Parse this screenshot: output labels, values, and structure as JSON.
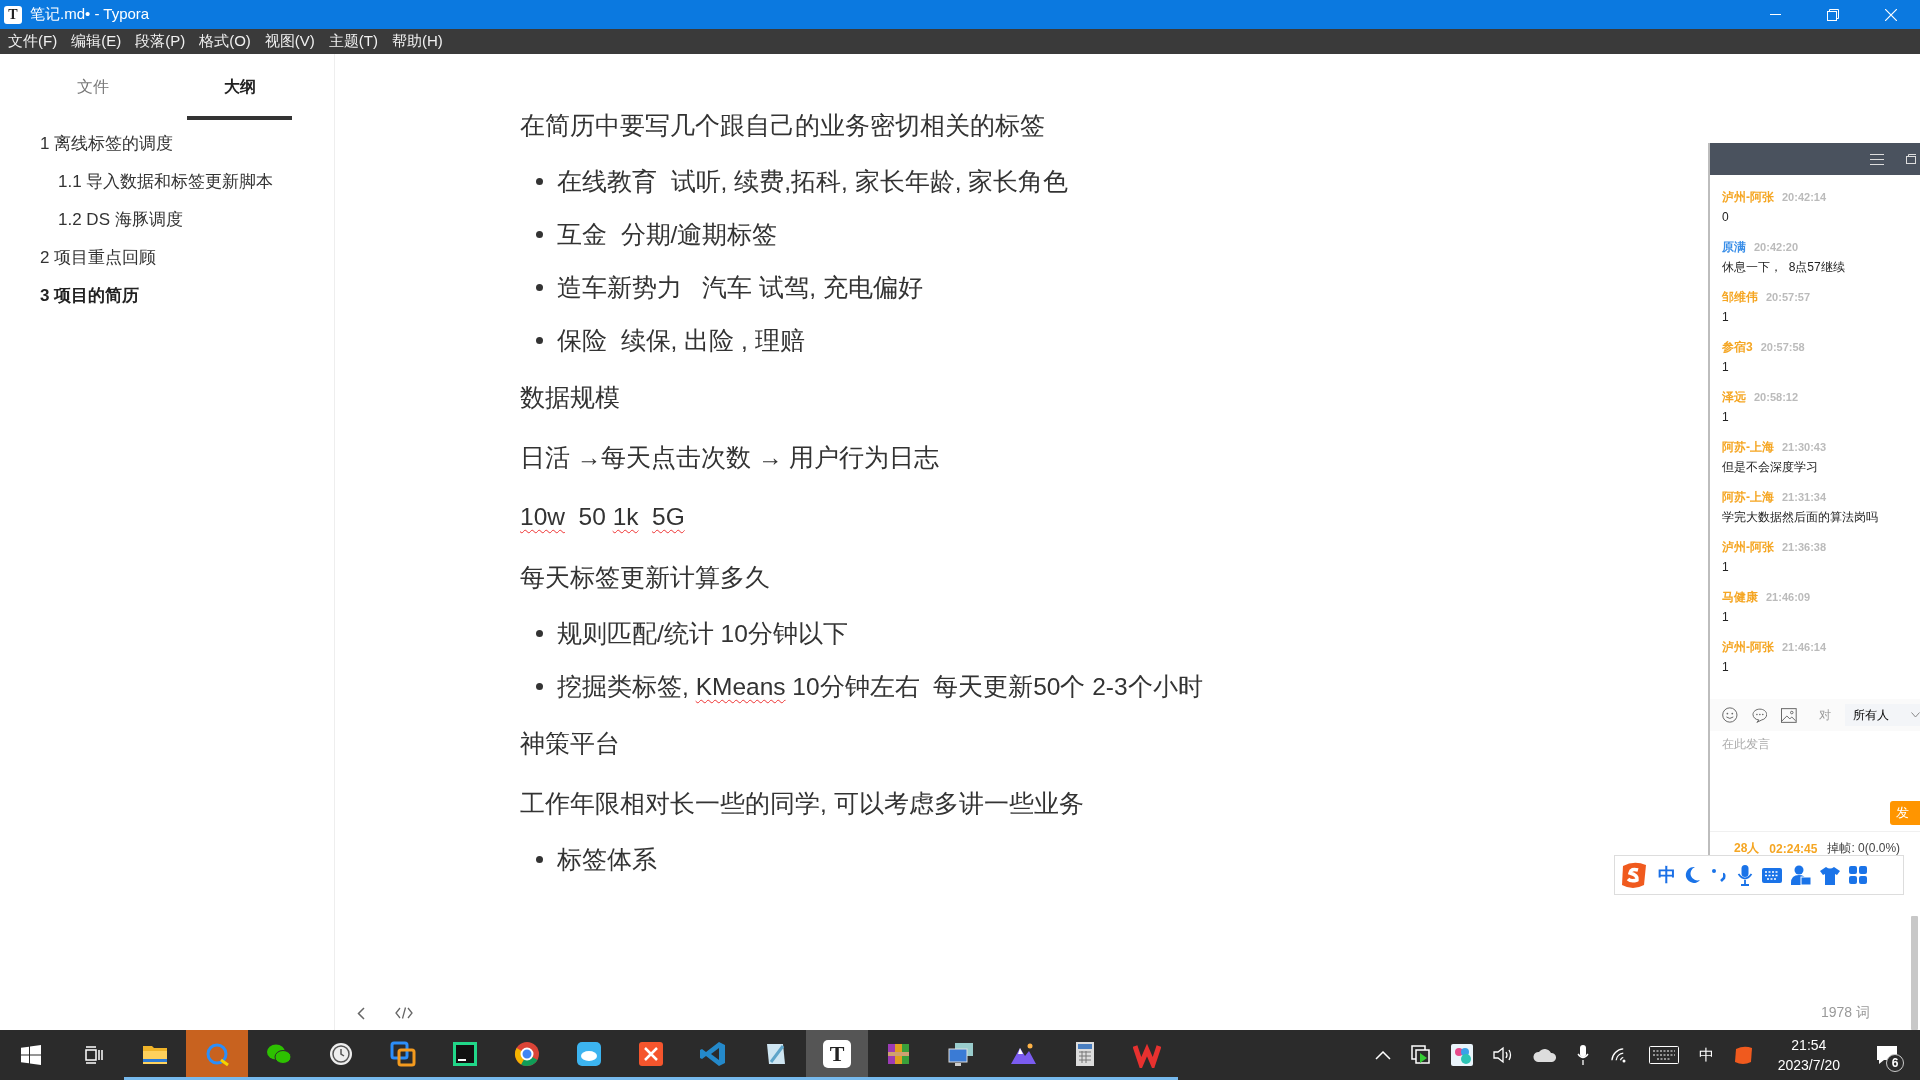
{
  "window": {
    "icon_letter": "T",
    "title": "笔记.md• - Typora"
  },
  "menu": [
    "文件(F)",
    "编辑(E)",
    "段落(P)",
    "格式(O)",
    "视图(V)",
    "主题(T)",
    "帮助(H)"
  ],
  "sidebar": {
    "tabs": [
      {
        "label": "文件",
        "selected": false
      },
      {
        "label": "大纲",
        "selected": true
      }
    ],
    "outline": [
      {
        "label": "1 离线标签的调度",
        "selected": false,
        "children": [
          {
            "label": "1.1 导入数据和标签更新脚本",
            "selected": false
          },
          {
            "label": "1.2 DS 海豚调度",
            "selected": false
          }
        ]
      },
      {
        "label": "2 项目重点回顾",
        "selected": false
      },
      {
        "label": "3 项目的简历",
        "selected": true
      }
    ]
  },
  "editor": {
    "blocks": [
      {
        "kind": "para",
        "segments": [
          {
            "text": "在简历中要写几个跟自己的业务密切相关的标签",
            "misspelled": false
          }
        ]
      },
      {
        "kind": "bullet",
        "segments": [
          {
            "text": "在线教育  试听, 续费,拓科, 家长年龄, 家长角色",
            "misspelled": false
          }
        ]
      },
      {
        "kind": "bullet",
        "segments": [
          {
            "text": "互金  分期/逾期标签",
            "misspelled": false
          }
        ]
      },
      {
        "kind": "bullet",
        "segments": [
          {
            "text": "造车新势力   汽车 试驾, 充电偏好",
            "misspelled": false
          }
        ]
      },
      {
        "kind": "bullet",
        "segments": [
          {
            "text": "保险  续保, 出险 , 理赔",
            "misspelled": false
          }
        ]
      },
      {
        "kind": "para",
        "segments": [
          {
            "text": "数据规模",
            "misspelled": false
          }
        ]
      },
      {
        "kind": "para",
        "segments": [
          {
            "text": "日活 →每天点击次数 → 用户行为日志",
            "misspelled": false
          }
        ]
      },
      {
        "kind": "para",
        "segments": [
          {
            "text": "10w",
            "misspelled": true
          },
          {
            "text": "  50 ",
            "misspelled": false
          },
          {
            "text": "1k",
            "misspelled": true
          },
          {
            "text": "5G",
            "misspelled": true
          }
        ]
      },
      {
        "kind": "para",
        "segments": [
          {
            "text": "每天标签更新计算多久",
            "misspelled": false
          }
        ]
      },
      {
        "kind": "bullet",
        "segments": [
          {
            "text": "规则匹配/统计 10分钟以下",
            "misspelled": false
          }
        ]
      },
      {
        "kind": "bullet",
        "segments": [
          {
            "text": "挖掘类标签, ",
            "misspelled": false
          },
          {
            "text": "KMeans",
            "misspelled": true
          },
          {
            "text": " 10分钟左右  每天更新50个 2-3个小时",
            "misspelled": false
          }
        ]
      },
      {
        "kind": "para",
        "segments": [
          {
            "text": "神策平台",
            "misspelled": false
          }
        ]
      },
      {
        "kind": "para",
        "segments": [
          {
            "text": "工作年限相对长一些的同学, 可以考虑多讲一些业务",
            "misspelled": false
          }
        ]
      },
      {
        "kind": "bullet",
        "segments": [
          {
            "text": "标签体系",
            "misspelled": false
          }
        ]
      }
    ],
    "word_count": "1978 词"
  },
  "chat": {
    "messages": [
      {
        "name": "泸州-阿张",
        "time": "20:42:14",
        "text": "0",
        "color": "#f5a623"
      },
      {
        "name": "原满",
        "time": "20:42:20",
        "text": "休息一下，  8点57继续",
        "color": "#3b8fe8"
      },
      {
        "name": "邹维伟",
        "time": "20:57:57",
        "text": "1",
        "color": "#f5a623"
      },
      {
        "name": "参宿3",
        "time": "20:57:58",
        "text": "1",
        "color": "#f5a623"
      },
      {
        "name": "泽远",
        "time": "20:58:12",
        "text": "1",
        "color": "#f5a623"
      },
      {
        "name": "阿苏-上海",
        "time": "21:30:43",
        "text": "但是不会深度学习",
        "color": "#f5a623"
      },
      {
        "name": "阿苏-上海",
        "time": "21:31:34",
        "text": "学完大数据然后面的算法岗吗",
        "color": "#f5a623"
      },
      {
        "name": "泸州-阿张",
        "time": "21:36:38",
        "text": "1",
        "color": "#f5a623"
      },
      {
        "name": "马健康",
        "time": "21:46:09",
        "text": "1",
        "color": "#f5a623"
      },
      {
        "name": "泸州-阿张",
        "time": "21:46:14",
        "text": "1",
        "color": "#f5a623"
      }
    ],
    "recipient_label": "对",
    "recipient": "所有人",
    "placeholder": "在此发言",
    "send": "发",
    "online": "28人",
    "duration": "02:24:45",
    "dropped_frames": "掉帧: 0(0.0%)"
  },
  "ime": {
    "mode": "中"
  },
  "taskbar": {
    "apps": [
      {
        "kind": "folder",
        "selected": false
      },
      {
        "kind": "sync",
        "selected": true
      },
      {
        "kind": "chat",
        "selected": false
      },
      {
        "kind": "clock",
        "selected": false
      },
      {
        "kind": "squares",
        "selected": false
      },
      {
        "kind": "ide",
        "selected": false
      },
      {
        "kind": "browser",
        "selected": false
      },
      {
        "kind": "cloud",
        "selected": false
      },
      {
        "kind": "cross",
        "selected": false
      },
      {
        "kind": "code",
        "selected": false
      },
      {
        "kind": "notepad",
        "selected": false
      },
      {
        "kind": "letter",
        "letter": "T",
        "selected": true
      },
      {
        "kind": "archive",
        "selected": false
      },
      {
        "kind": "monitor",
        "selected": false
      },
      {
        "kind": "mountain",
        "selected": false
      },
      {
        "kind": "calculator",
        "selected": false
      },
      {
        "kind": "office",
        "selected": false
      }
    ],
    "input_mode": "中",
    "time": "21:54",
    "date": "2023/7/20",
    "notifications": "6"
  }
}
